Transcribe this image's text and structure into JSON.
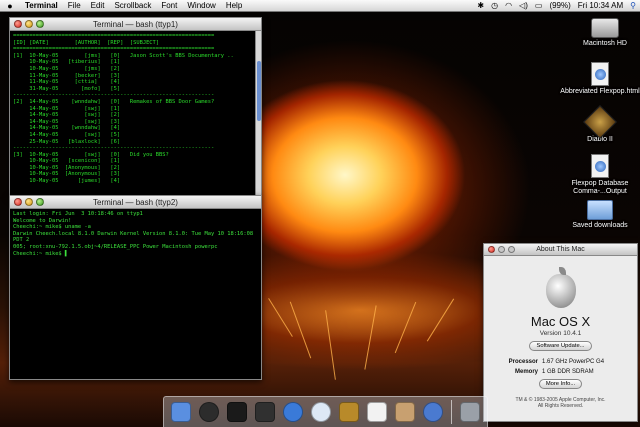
{
  "menubar": {
    "apple": "",
    "items": [
      "Terminal",
      "File",
      "Edit",
      "Scrollback",
      "Font",
      "Window",
      "Help"
    ],
    "battery": "(99%)",
    "clock": "Fri 10:34 AM"
  },
  "desktop_icons": [
    {
      "label": "Macintosh HD",
      "icon": "hard-drive-icon"
    },
    {
      "label": "Abbreviated Flexpop.html",
      "icon": "html-document-icon"
    },
    {
      "label": "Diablo II",
      "icon": "diablo-game-icon"
    },
    {
      "label": "Flexpop Database Comma-...Output",
      "icon": "database-document-icon"
    },
    {
      "label": "Saved downloads",
      "icon": "folder-icon"
    }
  ],
  "terminal1": {
    "title": "Terminal — bash (ttyp1)",
    "lines": [
      "==============================================================",
      "[ID] [DATE]        [AUTHOR]  [REP]  [SUBJECT]",
      "==============================================================",
      "[1]  10-May-05        [jms]   [0]   Jason Scott's BBS Documentary ..",
      "     10-May-05   [tiberius]   [1]",
      "     10-May-05        [jms]   [2]",
      "     11-May-05     [becker]   [3]",
      "     11-May-05     [cttia]    [4]",
      "     31-May-05       [mofo]   [5]",
      "--------------------------------------------------------------",
      "[2]  14-May-05    [wnndahw]   [0]   Remakes of BBS Door Games?",
      "     14-May-05        [swj]   [1]",
      "     14-May-05        [swj]   [2]",
      "     14-May-05        [swj]   [3]",
      "     14-May-05    [wnndahw]   [4]",
      "     14-May-05        [swj]   [5]",
      "     25-May-05   [blaxlock]   [6]",
      "--------------------------------------------------------------",
      "[3]  10-May-05        [swj]   [0]   Did you BBS?",
      "     10-May-05   [scenicon]   [1]",
      "     10-May-05  [Anonymous]   [2]",
      "     10-May-05  [Anonymous]   [3]",
      "     10-May-05      [jumes]   [4]"
    ]
  },
  "terminal2": {
    "title": "Terminal — bash (ttyp2)",
    "lines": [
      "Last login: Fri Jun  3 10:18:46 on ttyp1",
      "Welcome to Darwin!",
      "Cheechi:~ mike$ uname -a",
      "Darwin Cheech.local 8.1.0 Darwin Kernel Version 8.1.0: Tue May 10 18:16:08 PDT 2",
      "005; root:xnu-792.1.5.obj~4/RELEASE_PPC Power Macintosh powerpc",
      "Cheechi:~ mike$ ▌"
    ]
  },
  "about": {
    "title": "About This Mac",
    "os_name": "Mac OS X",
    "version": "Version 10.4.1",
    "software_update": "Software Update...",
    "processor_label": "Processor",
    "processor_value": "1.67 GHz PowerPC G4",
    "memory_label": "Memory",
    "memory_value": "1 GB DDR SDRAM",
    "more_info": "More Info...",
    "copyright_1": "TM & © 1983-2005 Apple Computer, Inc.",
    "copyright_2": "All Rights Reserved."
  },
  "dock": {
    "items": [
      {
        "name": "finder",
        "color": "#5a8fe0"
      },
      {
        "name": "dashboard",
        "color": "#2c2c2c"
      },
      {
        "name": "terminal",
        "color": "#1a1a1a"
      },
      {
        "name": "activity-monitor",
        "color": "#303030"
      },
      {
        "name": "safari",
        "color": "#3a7ad8"
      },
      {
        "name": "itunes",
        "color": "#dde8f5"
      },
      {
        "name": "world-of-warcraft",
        "color": "#b88a2a"
      },
      {
        "name": "ical",
        "color": "#f2f2f2"
      },
      {
        "name": "address-book",
        "color": "#c8a070"
      },
      {
        "name": "quicktime",
        "color": "#4a7ad0"
      },
      {
        "name": "trash",
        "color": "#9aa0a8"
      }
    ]
  }
}
